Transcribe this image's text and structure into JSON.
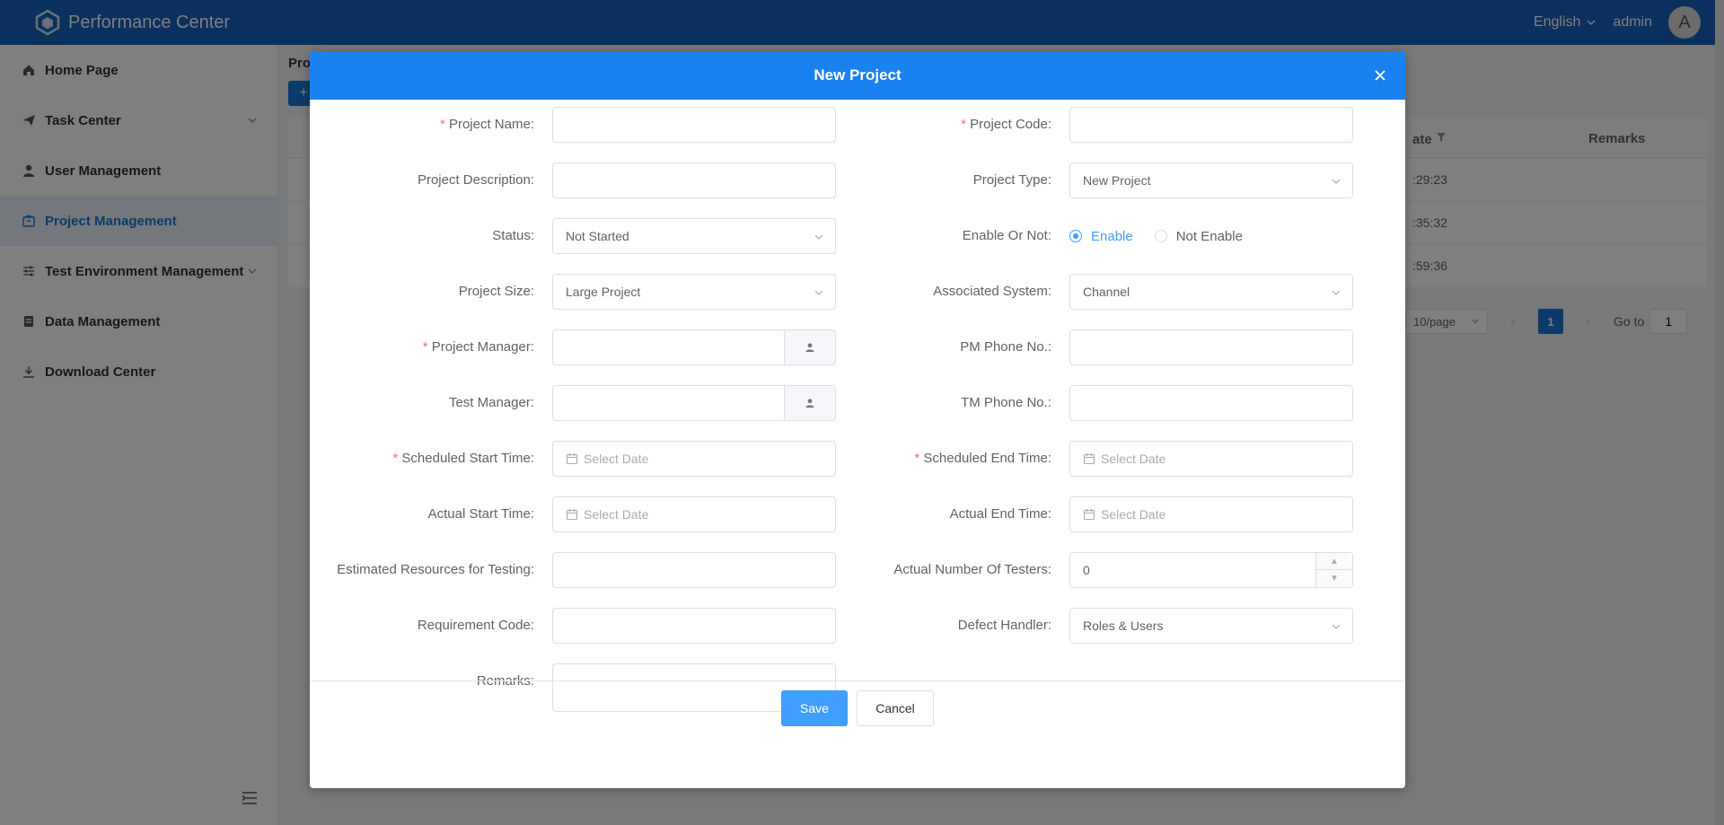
{
  "app": {
    "title": "Performance Center"
  },
  "header": {
    "language": "English",
    "user": "admin",
    "avatar_letter": "A"
  },
  "sidebar": {
    "items": [
      {
        "label": "Home Page",
        "icon": "home-icon"
      },
      {
        "label": "Task Center",
        "icon": "send-icon",
        "expandable": true
      },
      {
        "label": "User Management",
        "icon": "user-icon"
      },
      {
        "label": "Project Management",
        "icon": "briefcase-icon",
        "active": true
      },
      {
        "label": "Test Environment Management",
        "icon": "sliders-icon",
        "expandable": true
      },
      {
        "label": "Data Management",
        "icon": "database-icon"
      },
      {
        "label": "Download Center",
        "icon": "download-icon"
      }
    ]
  },
  "background": {
    "breadcrumb": "Proj",
    "add_label": "+",
    "columns": {
      "date": "ate",
      "remarks": "Remarks"
    },
    "rows": [
      ":29:23",
      ":35:32",
      ":59:36"
    ],
    "pager": {
      "page_size": "10/page",
      "current": "1",
      "goto_label": "Go to",
      "goto_value": "1"
    }
  },
  "dialog": {
    "title": "New Project",
    "left": [
      {
        "label": "Project Name:",
        "required": true,
        "value": ""
      },
      {
        "label": "Project Description:",
        "required": false,
        "value": ""
      },
      {
        "label": "Status:",
        "required": false,
        "value": "Not Started"
      },
      {
        "label": "Project Size:",
        "required": false,
        "value": "Large Project"
      },
      {
        "label": "Project Manager:",
        "required": true,
        "value": ""
      },
      {
        "label": "Test Manager:",
        "required": false,
        "value": ""
      },
      {
        "label": "Scheduled Start Time:",
        "required": true,
        "placeholder": "Select Date"
      },
      {
        "label": "Actual Start Time:",
        "required": false,
        "placeholder": "Select Date"
      },
      {
        "label": "Estimated Resources for Testing:",
        "required": false,
        "value": ""
      },
      {
        "label": "Requirement Code:",
        "required": false,
        "value": ""
      },
      {
        "label": "Remarks:",
        "required": false,
        "value": ""
      }
    ],
    "right": [
      {
        "label": "Project Code:",
        "required": true,
        "value": ""
      },
      {
        "label": "Project Type:",
        "required": false,
        "value": "New Project"
      },
      {
        "label": "Enable Or Not:",
        "required": false,
        "options": [
          "Enable",
          "Not Enable"
        ],
        "selected": "Enable"
      },
      {
        "label": "Associated System:",
        "required": false,
        "value": "Channel"
      },
      {
        "label": "PM Phone No.:",
        "required": false,
        "value": ""
      },
      {
        "label": "TM Phone No.:",
        "required": false,
        "value": ""
      },
      {
        "label": "Scheduled End Time:",
        "required": true,
        "placeholder": "Select Date"
      },
      {
        "label": "Actual End Time:",
        "required": false,
        "placeholder": "Select Date"
      },
      {
        "label": "Actual Number Of Testers:",
        "required": false,
        "value": "0"
      },
      {
        "label": "Defect Handler:",
        "required": false,
        "value": "Roles & Users"
      }
    ],
    "buttons": {
      "save": "Save",
      "cancel": "Cancel"
    }
  },
  "colors": {
    "header": "#1560bd",
    "dialog_header": "#1a82f0",
    "primary": "#409eff",
    "required": "#f56c6c",
    "active_nav": "#1976d2"
  }
}
